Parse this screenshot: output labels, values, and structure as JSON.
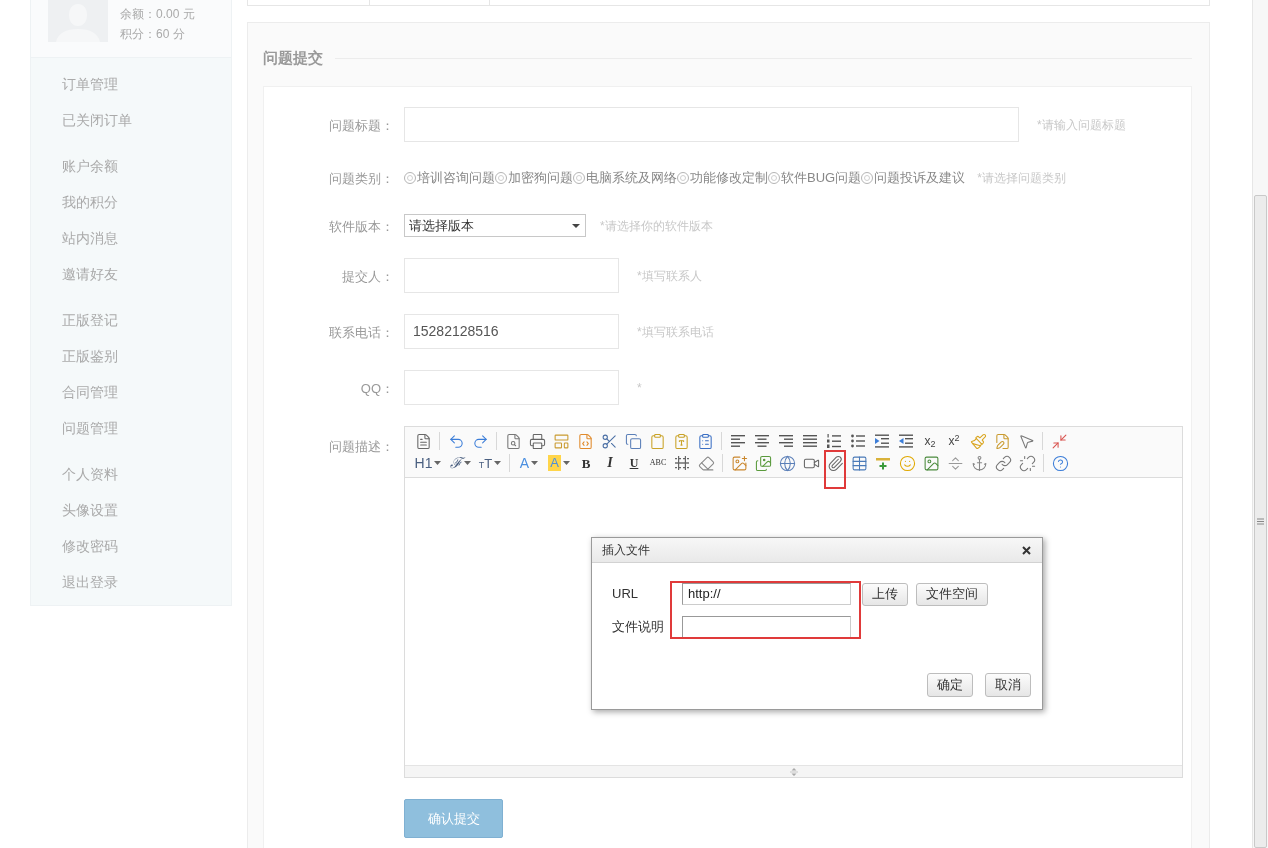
{
  "sidebar": {
    "balance": "余额：0.00 元",
    "points": "积分：60 分",
    "menu_groups": [
      [
        {
          "label": "订单管理",
          "selected": false
        },
        {
          "label": "已关闭订单",
          "selected": false
        }
      ],
      [
        {
          "label": "账户余额",
          "selected": false
        },
        {
          "label": "我的积分",
          "selected": false
        },
        {
          "label": "站内消息",
          "selected": false
        },
        {
          "label": "邀请好友",
          "selected": false
        }
      ],
      [
        {
          "label": "正版登记",
          "selected": false
        },
        {
          "label": "正版鉴别",
          "selected": false
        },
        {
          "label": "合同管理",
          "selected": false
        },
        {
          "label": "问题管理",
          "selected": false
        }
      ],
      [
        {
          "label": "个人资料",
          "selected": false
        },
        {
          "label": "头像设置",
          "selected": false
        },
        {
          "label": "修改密码",
          "selected": false
        },
        {
          "label": "退出登录",
          "selected": false
        }
      ]
    ]
  },
  "panel": {
    "title": "问题提交"
  },
  "form": {
    "fields": [
      {
        "kind": "long_text",
        "label": "问题标题：",
        "hint": "*请输入问题标题"
      },
      {
        "kind": "radio",
        "label": "问题类别：",
        "options": [
          {
            "label": "培训咨询问题",
            "selected": false
          },
          {
            "label": "加密狗问题",
            "selected": false
          },
          {
            "label": "电脑系统及网络",
            "selected": false
          },
          {
            "label": "功能修改定制",
            "selected": false
          },
          {
            "label": "软件BUG问题",
            "selected": false
          },
          {
            "label": "问题投诉及建议",
            "selected": false
          }
        ],
        "hint": "*请选择问题类别"
      },
      {
        "kind": "select",
        "label": "软件版本：",
        "value": "请选择版本",
        "hint": "*请选择你的软件版本"
      },
      {
        "kind": "text",
        "label": "提交人：",
        "hint": "*填写联系人"
      },
      {
        "kind": "text",
        "label": "联系电话：",
        "value": "15282128516",
        "hint": "*填写联系电话"
      },
      {
        "kind": "text",
        "label": "QQ：",
        "hint": "*"
      }
    ],
    "editor": {
      "label": "问题描述：",
      "toolbar_texts": [
        "x$_{2}$",
        "x$^{2}$",
        "H1",
        "ℱ",
        "TT",
        "A",
        "A",
        "B",
        "I",
        "U",
        "ABC"
      ],
      "attachment_highlighted": true
    },
    "submit": "确认提交"
  },
  "dialog": {
    "title": "插入文件",
    "fields": [
      {
        "label": "URL",
        "value": "http://"
      },
      {
        "label": "文件说明"
      }
    ],
    "side_buttons": [
      "上传",
      "文件空间"
    ],
    "buttons": [
      "确定",
      "取消"
    ],
    "fields_highlighted": true
  }
}
